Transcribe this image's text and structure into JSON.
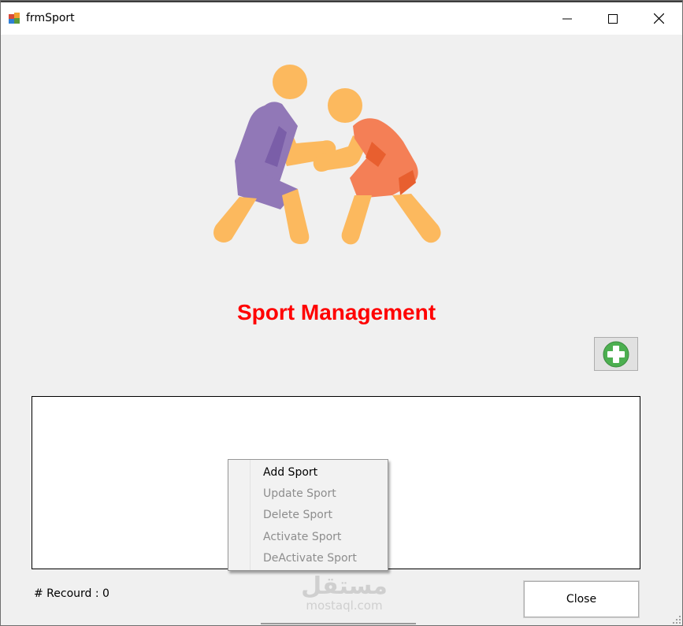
{
  "window": {
    "title": "frmSport",
    "controls": [
      "minimize-icon",
      "maximize-icon",
      "close-icon"
    ]
  },
  "page": {
    "heading": "Sport Management",
    "heading_color": "#ff0000",
    "hero_icon": "wrestling-icon"
  },
  "toolbar": {
    "add_icon": "plus-circle-icon",
    "add_icon_color": "#4caf50"
  },
  "context_menu": {
    "items": [
      {
        "label": "Add Sport",
        "enabled": true
      },
      {
        "label": "Update Sport",
        "enabled": false
      },
      {
        "label": "Delete Sport",
        "enabled": false
      },
      {
        "label": "Activate Sport",
        "enabled": false
      },
      {
        "label": "DeActivate Sport",
        "enabled": false
      }
    ]
  },
  "footer": {
    "record_label": "#   Recourd :  0",
    "close_label": "Close"
  },
  "watermark": {
    "logo": "مستقل",
    "site": "mostaql.com"
  }
}
